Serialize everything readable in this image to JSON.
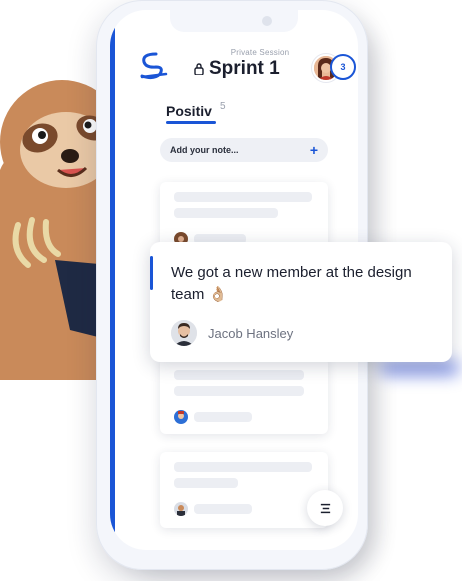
{
  "header": {
    "session_label": "Private Session",
    "title": "Sprint 1",
    "participant_count": "3"
  },
  "column": {
    "title": "Positiv",
    "count": "5",
    "add_note_label": "Add your note..."
  },
  "featured_note": {
    "text": "We got a new member at the design team 👌🏼",
    "author": "Jacob Hansley"
  },
  "icons": {
    "logo": "brand-logo",
    "lock": "lock-icon",
    "add": "plus-icon",
    "menu": "menu-icon"
  },
  "colors": {
    "accent": "#1a55d6",
    "text": "#1b1f2e",
    "muted": "#9aa0ad",
    "placeholder": "#eceef3"
  }
}
